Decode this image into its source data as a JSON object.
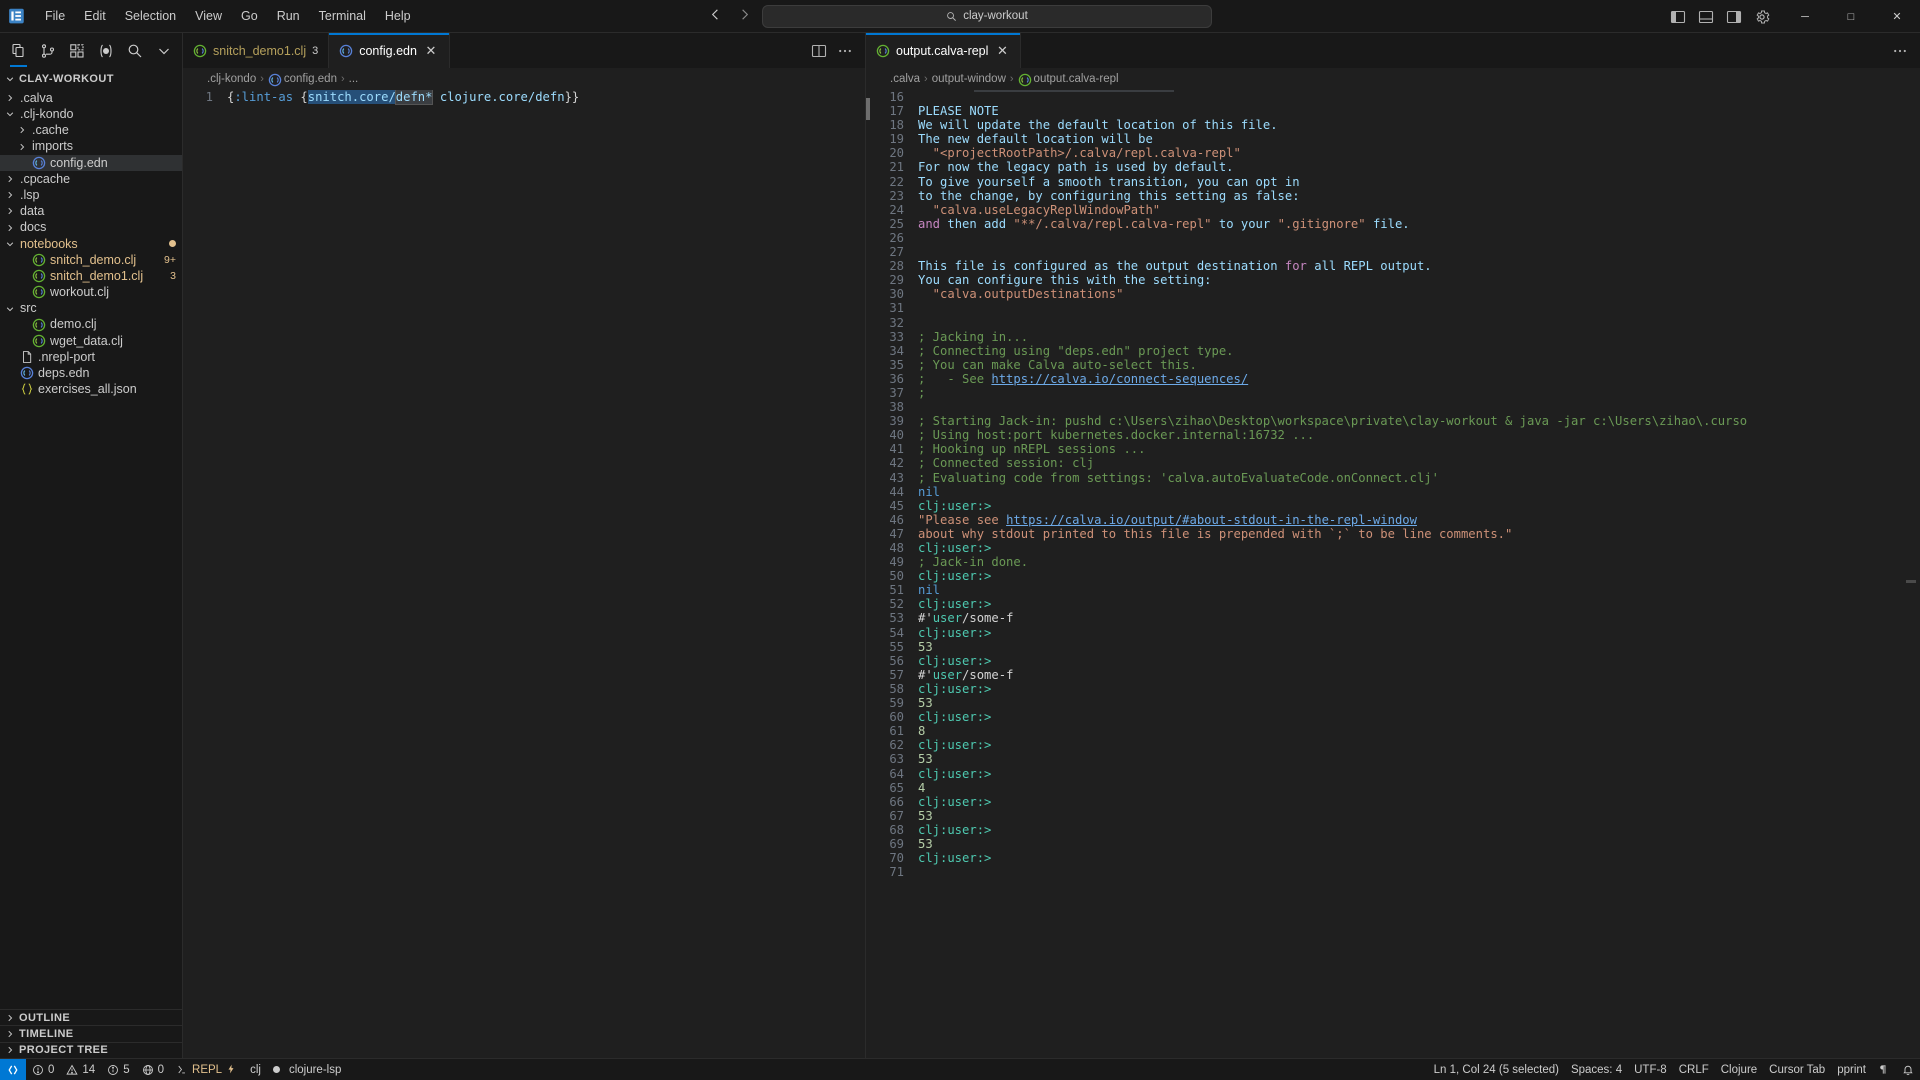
{
  "titlebar": {
    "logo_icon": "vscode-logo",
    "menu": [
      "File",
      "Edit",
      "Selection",
      "View",
      "Go",
      "Run",
      "Terminal",
      "Help"
    ],
    "nav_back_icon": "arrow-left-icon",
    "nav_forward_icon": "arrow-right-icon",
    "command_center": {
      "icon": "search-icon",
      "text": "clay-workout"
    },
    "layout_icons": [
      "toggle-primary-sidebar-icon",
      "toggle-panel-icon",
      "toggle-secondary-sidebar-icon",
      "customize-layout-icon",
      "manage-settings-icon"
    ],
    "window_buttons": {
      "minimize": "─",
      "maximize": "□",
      "close": "✕"
    }
  },
  "sidebar": {
    "toolbar_icons": [
      "explorer-icon",
      "source-control-icon",
      "extensions-icon",
      "calva-icon",
      "search-icon",
      "chevron-down-icon"
    ],
    "section_title": "CLAY-WORKOUT",
    "tree": [
      {
        "label": ".calva",
        "type": "folder",
        "expanded": false,
        "indent": 1
      },
      {
        "label": ".clj-kondo",
        "type": "folder",
        "expanded": true,
        "indent": 1
      },
      {
        "label": ".cache",
        "type": "folder",
        "expanded": false,
        "indent": 2
      },
      {
        "label": "imports",
        "type": "folder",
        "expanded": false,
        "indent": 2
      },
      {
        "label": "config.edn",
        "type": "clj",
        "indent": 2,
        "selected": true
      },
      {
        "label": ".cpcache",
        "type": "folder",
        "expanded": false,
        "indent": 1
      },
      {
        "label": ".lsp",
        "type": "folder",
        "expanded": false,
        "indent": 1
      },
      {
        "label": "data",
        "type": "folder",
        "expanded": false,
        "indent": 1
      },
      {
        "label": "docs",
        "type": "folder",
        "expanded": false,
        "indent": 1
      },
      {
        "label": "notebooks",
        "type": "folder",
        "expanded": true,
        "indent": 1,
        "modified": true
      },
      {
        "label": "snitch_demo.clj",
        "type": "clj",
        "indent": 2,
        "badge": "9+"
      },
      {
        "label": "snitch_demo1.clj",
        "type": "clj",
        "indent": 2,
        "badge": "3"
      },
      {
        "label": "workout.clj",
        "type": "clj",
        "indent": 2
      },
      {
        "label": "src",
        "type": "folder",
        "expanded": true,
        "indent": 1
      },
      {
        "label": "demo.clj",
        "type": "clj",
        "indent": 2
      },
      {
        "label": "wget_data.clj",
        "type": "clj",
        "indent": 2
      },
      {
        "label": ".nrepl-port",
        "type": "file",
        "indent": 1
      },
      {
        "label": "deps.edn",
        "type": "clj",
        "indent": 1
      },
      {
        "label": "exercises_all.json",
        "type": "json",
        "indent": 1
      }
    ],
    "panels": [
      "OUTLINE",
      "TIMELINE",
      "PROJECT TREE"
    ]
  },
  "editor_left": {
    "tabs": [
      {
        "label": "snitch_demo1.clj",
        "count": "3",
        "active": false,
        "icon": "clj-icon"
      },
      {
        "label": "config.edn",
        "count": "",
        "active": true,
        "icon": "clj-icon",
        "close": "✕"
      }
    ],
    "actions": [
      "split-editor-icon",
      "more-actions-icon"
    ],
    "breadcrumb": [
      ".clj-kondo",
      "config.edn",
      "..."
    ],
    "lines": [
      {
        "num": "1",
        "tokens": [
          {
            "text": "{",
            "cls": "t-brace"
          },
          {
            "text": ":lint-as",
            "cls": "t-key"
          },
          {
            "text": " ",
            "cls": "t-plain"
          },
          {
            "text": "{",
            "cls": "t-brace"
          },
          {
            "text": "snitch.core/",
            "cls": "t-sym",
            "sel": true
          },
          {
            "text": "defn*",
            "cls": "t-sym",
            "hl": true
          },
          {
            "text": " ",
            "cls": "t-plain"
          },
          {
            "text": "clojure.core/defn",
            "cls": "t-sym"
          },
          {
            "text": "}}",
            "cls": "t-brace"
          }
        ]
      }
    ]
  },
  "editor_right": {
    "actions": [
      "split-editor-icon",
      "more-actions-icon"
    ],
    "tabs": [
      {
        "label": "output.calva-repl",
        "active": true,
        "icon": "clj-icon",
        "close": "✕"
      }
    ],
    "breadcrumb": [
      ".calva",
      "output-window",
      "output.calva-repl"
    ],
    "more_icon": "more-actions-icon",
    "lines": [
      {
        "num": "16",
        "tokens": []
      },
      {
        "num": "17",
        "tokens": [
          {
            "text": "PLEASE NOTE",
            "cls": "t-sym"
          }
        ]
      },
      {
        "num": "18",
        "tokens": [
          {
            "text": "We will update the default location of this file.",
            "cls": "t-sym"
          }
        ]
      },
      {
        "num": "19",
        "tokens": [
          {
            "text": "The new default location will be",
            "cls": "t-sym"
          }
        ]
      },
      {
        "num": "20",
        "tokens": [
          {
            "text": "  \"<projectRootPath>/.calva/repl.calva-repl\"",
            "cls": "t-str"
          }
        ]
      },
      {
        "num": "21",
        "tokens": [
          {
            "text": "For now the legacy path is used by default.",
            "cls": "t-sym"
          }
        ]
      },
      {
        "num": "22",
        "tokens": [
          {
            "text": "To give yourself a smooth transition, you can opt in",
            "cls": "t-sym"
          }
        ]
      },
      {
        "num": "23",
        "tokens": [
          {
            "text": "to the change, by configuring this setting as false:",
            "cls": "t-sym"
          }
        ]
      },
      {
        "num": "24",
        "tokens": [
          {
            "text": "  \"calva.useLegacyReplWindowPath\"",
            "cls": "t-str"
          }
        ]
      },
      {
        "num": "25",
        "tokens": [
          {
            "text": "and",
            "cls": "t-ctl"
          },
          {
            "text": " then add ",
            "cls": "t-sym"
          },
          {
            "text": "\"**/.calva/repl.calva-repl\"",
            "cls": "t-str"
          },
          {
            "text": " to your ",
            "cls": "t-sym"
          },
          {
            "text": "\".gitignore\"",
            "cls": "t-str"
          },
          {
            "text": " file.",
            "cls": "t-sym"
          }
        ]
      },
      {
        "num": "26",
        "tokens": []
      },
      {
        "num": "27",
        "tokens": []
      },
      {
        "num": "28",
        "tokens": [
          {
            "text": "This file is configured as the output destination ",
            "cls": "t-sym"
          },
          {
            "text": "for",
            "cls": "t-ctl"
          },
          {
            "text": " all REPL output.",
            "cls": "t-sym"
          }
        ]
      },
      {
        "num": "29",
        "tokens": [
          {
            "text": "You can configure this with the setting:",
            "cls": "t-sym"
          }
        ]
      },
      {
        "num": "30",
        "tokens": [
          {
            "text": "  \"calva.outputDestinations\"",
            "cls": "t-str"
          }
        ]
      },
      {
        "num": "31",
        "tokens": []
      },
      {
        "num": "32",
        "tokens": []
      },
      {
        "num": "33",
        "tokens": [
          {
            "text": "; Jacking in...",
            "cls": "t-com"
          }
        ]
      },
      {
        "num": "34",
        "tokens": [
          {
            "text": "; Connecting using \"deps.edn\" project type.",
            "cls": "t-com"
          }
        ]
      },
      {
        "num": "35",
        "tokens": [
          {
            "text": "; You can make Calva auto-select this.",
            "cls": "t-com"
          }
        ]
      },
      {
        "num": "36",
        "tokens": [
          {
            "text": ";   - See ",
            "cls": "t-com"
          },
          {
            "text": "https://calva.io/connect-sequences/",
            "cls": "t-link"
          }
        ]
      },
      {
        "num": "37",
        "tokens": [
          {
            "text": ";",
            "cls": "t-com"
          }
        ]
      },
      {
        "num": "38",
        "tokens": []
      },
      {
        "num": "39",
        "tokens": [
          {
            "text": "; Starting Jack-in: pushd c:\\Users\\zihao\\Desktop\\workspace\\private\\clay-workout & java -jar c:\\Users\\zihao\\.curso",
            "cls": "t-com"
          }
        ]
      },
      {
        "num": "40",
        "tokens": [
          {
            "text": "; Using host:port kubernetes.docker.internal:16732 ...",
            "cls": "t-com"
          }
        ]
      },
      {
        "num": "41",
        "tokens": [
          {
            "text": "; Hooking up nREPL sessions ...",
            "cls": "t-com"
          }
        ]
      },
      {
        "num": "42",
        "tokens": [
          {
            "text": "; Connected session: clj",
            "cls": "t-com"
          }
        ]
      },
      {
        "num": "43",
        "tokens": [
          {
            "text": "; Evaluating code from settings: 'calva.autoEvaluateCode.onConnect.clj'",
            "cls": "t-com"
          }
        ]
      },
      {
        "num": "44",
        "tokens": [
          {
            "text": "nil",
            "cls": "t-nil"
          }
        ]
      },
      {
        "num": "45",
        "tokens": [
          {
            "text": "clj:user:>",
            "cls": "t-prompt"
          }
        ]
      },
      {
        "num": "46",
        "tokens": [
          {
            "text": "\"Please see ",
            "cls": "t-str"
          },
          {
            "text": "https://calva.io/output/#about-stdout-in-the-repl-window",
            "cls": "t-link"
          }
        ]
      },
      {
        "num": "47",
        "tokens": [
          {
            "text": "about why stdout printed to this file is prepended with `;` to be line comments.\"",
            "cls": "t-str"
          }
        ]
      },
      {
        "num": "48",
        "tokens": [
          {
            "text": "clj:user:>",
            "cls": "t-prompt"
          }
        ]
      },
      {
        "num": "49",
        "tokens": [
          {
            "text": "; Jack-in done.",
            "cls": "t-com"
          }
        ]
      },
      {
        "num": "50",
        "tokens": [
          {
            "text": "clj:user:>",
            "cls": "t-prompt"
          }
        ]
      },
      {
        "num": "51",
        "tokens": [
          {
            "text": "nil",
            "cls": "t-nil"
          }
        ]
      },
      {
        "num": "52",
        "tokens": [
          {
            "text": "clj:user:>",
            "cls": "t-prompt"
          }
        ]
      },
      {
        "num": "53",
        "tokens": [
          {
            "text": "#'",
            "cls": "t-white"
          },
          {
            "text": "user",
            "cls": "t-prompt"
          },
          {
            "text": "/some-f",
            "cls": "t-white"
          }
        ]
      },
      {
        "num": "54",
        "tokens": [
          {
            "text": "clj:user:>",
            "cls": "t-prompt"
          }
        ]
      },
      {
        "num": "55",
        "tokens": [
          {
            "text": "53",
            "cls": "t-num"
          }
        ]
      },
      {
        "num": "56",
        "tokens": [
          {
            "text": "clj:user:>",
            "cls": "t-prompt"
          }
        ]
      },
      {
        "num": "57",
        "tokens": [
          {
            "text": "#'",
            "cls": "t-white"
          },
          {
            "text": "user",
            "cls": "t-prompt"
          },
          {
            "text": "/some-f",
            "cls": "t-white"
          }
        ]
      },
      {
        "num": "58",
        "tokens": [
          {
            "text": "clj:user:>",
            "cls": "t-prompt"
          }
        ]
      },
      {
        "num": "59",
        "tokens": [
          {
            "text": "53",
            "cls": "t-num"
          }
        ]
      },
      {
        "num": "60",
        "tokens": [
          {
            "text": "clj:user:>",
            "cls": "t-prompt"
          }
        ]
      },
      {
        "num": "61",
        "tokens": [
          {
            "text": "8",
            "cls": "t-num"
          }
        ]
      },
      {
        "num": "62",
        "tokens": [
          {
            "text": "clj:user:>",
            "cls": "t-prompt"
          }
        ]
      },
      {
        "num": "63",
        "tokens": [
          {
            "text": "53",
            "cls": "t-num"
          }
        ]
      },
      {
        "num": "64",
        "tokens": [
          {
            "text": "clj:user:>",
            "cls": "t-prompt"
          }
        ]
      },
      {
        "num": "65",
        "tokens": [
          {
            "text": "4",
            "cls": "t-num"
          }
        ]
      },
      {
        "num": "66",
        "tokens": [
          {
            "text": "clj:user:>",
            "cls": "t-prompt"
          }
        ]
      },
      {
        "num": "67",
        "tokens": [
          {
            "text": "53",
            "cls": "t-num"
          }
        ]
      },
      {
        "num": "68",
        "tokens": [
          {
            "text": "clj:user:>",
            "cls": "t-prompt"
          }
        ]
      },
      {
        "num": "69",
        "tokens": [
          {
            "text": "53",
            "cls": "t-num"
          }
        ]
      },
      {
        "num": "70",
        "tokens": [
          {
            "text": "clj:user:>",
            "cls": "t-prompt"
          }
        ]
      },
      {
        "num": "71",
        "tokens": []
      }
    ]
  },
  "statusbar": {
    "remote": {
      "icon": "remote-indicator-icon",
      "label": ""
    },
    "left": [
      {
        "icon": "error-icon",
        "label": "0"
      },
      {
        "icon": "warning-icon",
        "label": "14"
      },
      {
        "icon": "info-icon",
        "label": "5"
      },
      {
        "icon": "ports-icon",
        "label": "0"
      },
      {
        "icon": "repl-icon",
        "label": "REPL"
      },
      {
        "icon": "",
        "label": "clj"
      },
      {
        "icon": "status-dot-icon",
        "label": "clojure-lsp"
      }
    ],
    "right": [
      {
        "label": "Ln 1, Col 24 (5 selected)"
      },
      {
        "label": "Spaces: 4"
      },
      {
        "label": "UTF-8"
      },
      {
        "label": "CRLF"
      },
      {
        "label": "Clojure"
      },
      {
        "label": "Cursor Tab"
      },
      {
        "label": "pprint"
      },
      {
        "icon": "paragraph-icon",
        "label": ""
      },
      {
        "icon": "bell-icon",
        "label": ""
      }
    ]
  }
}
